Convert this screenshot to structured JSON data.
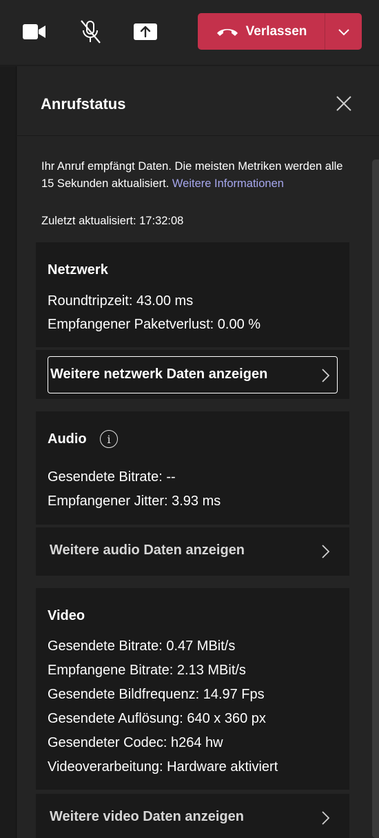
{
  "toolbar": {
    "camera_icon": "video-camera-icon",
    "mic_icon": "microphone-muted-icon",
    "share_icon": "share-screen-icon",
    "leave_label": "Verlassen",
    "leave_color": "#c4314b"
  },
  "panel": {
    "title": "Anrufstatus",
    "intro_text": "Ihr Anruf empfängt Daten. Die meisten Metriken werden alle 15 Sekunden aktualisiert.",
    "intro_link": "Weitere Informationen",
    "last_updated": "Zuletzt aktualisiert: 17:32:08",
    "link_color": "#a6a7ee"
  },
  "network": {
    "title": "Netzwerk",
    "metrics": [
      "Roundtripzeit: 43.00 ms",
      "Empfangener Paketverlust: 0.00 %"
    ],
    "more_label": "Weitere netzwerk Daten anzeigen"
  },
  "audio": {
    "title": "Audio",
    "metrics": [
      "Gesendete Bitrate: --",
      "Empfangener Jitter: 3.93 ms"
    ],
    "more_label": "Weitere audio Daten anzeigen"
  },
  "video": {
    "title": "Video",
    "metrics": [
      "Gesendete Bitrate: 0.47 MBit/s",
      "Empfangene Bitrate: 2.13 MBit/s",
      "Gesendete Bildfrequenz: 14.97 Fps",
      "Gesendete Auflösung: 640 x 360 px",
      "Gesendeter Codec: h264 hw",
      "Videoverarbeitung: Hardware aktiviert"
    ],
    "more_label": "Weitere video Daten anzeigen"
  }
}
